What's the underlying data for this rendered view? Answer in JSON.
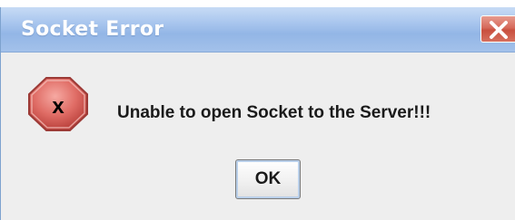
{
  "dialog": {
    "title": "Socket Error",
    "message": "Unable to open Socket to the Server!!!",
    "ok_label": "OK",
    "icon": "error-x-icon",
    "close_icon": "close-icon"
  },
  "colors": {
    "titlebar_start": "#c7dbf5",
    "titlebar_end": "#93b6e6",
    "content_background": "#eeeeee",
    "error_icon_red": "#c84a45",
    "close_button_red": "#d66a5b"
  }
}
